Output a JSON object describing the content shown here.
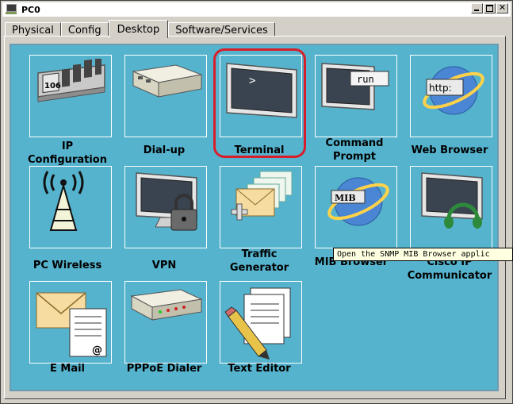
{
  "window": {
    "title": "PC0"
  },
  "tabs": [
    {
      "label": "Physical",
      "active": false
    },
    {
      "label": "Config",
      "active": false
    },
    {
      "label": "Desktop",
      "active": true
    },
    {
      "label": "Software/Services",
      "active": false
    }
  ],
  "desktop": {
    "apps": [
      {
        "id": "ip-configuration",
        "label_line1": "IP",
        "label_line2": "Configuration",
        "badge": "106"
      },
      {
        "id": "dial-up",
        "label_line1": "Dial-up"
      },
      {
        "id": "terminal",
        "label_line1": "Terminal",
        "badge": ">"
      },
      {
        "id": "command-prompt",
        "label_line1": "Command",
        "label_line2": "Prompt",
        "badge": "run"
      },
      {
        "id": "web-browser",
        "label_line1": "Web Browser",
        "badge": "http:"
      },
      {
        "id": "pc-wireless",
        "label_line1": "PC Wireless"
      },
      {
        "id": "vpn",
        "label_line1": "VPN"
      },
      {
        "id": "traffic-generator",
        "label_line1": "Traffic",
        "label_line2": "Generator"
      },
      {
        "id": "mib-browser",
        "label_line1": "MIB Browser",
        "badge": "MIB"
      },
      {
        "id": "cisco-ip-communicator",
        "label_line1": "Cisco IP",
        "label_line2": "Communicator"
      },
      {
        "id": "e-mail",
        "label_line1": "E Mail",
        "badge": "@"
      },
      {
        "id": "pppoe-dialer",
        "label_line1": "PPPoE Dialer"
      },
      {
        "id": "text-editor",
        "label_line1": "Text Editor"
      }
    ],
    "selected": "terminal",
    "tooltip": "Open the SNMP MIB Browser applic"
  },
  "colors": {
    "desktop_bg": "#55b3cd",
    "highlight": "#d91e2b",
    "tooltip_bg": "#ffffe1"
  }
}
